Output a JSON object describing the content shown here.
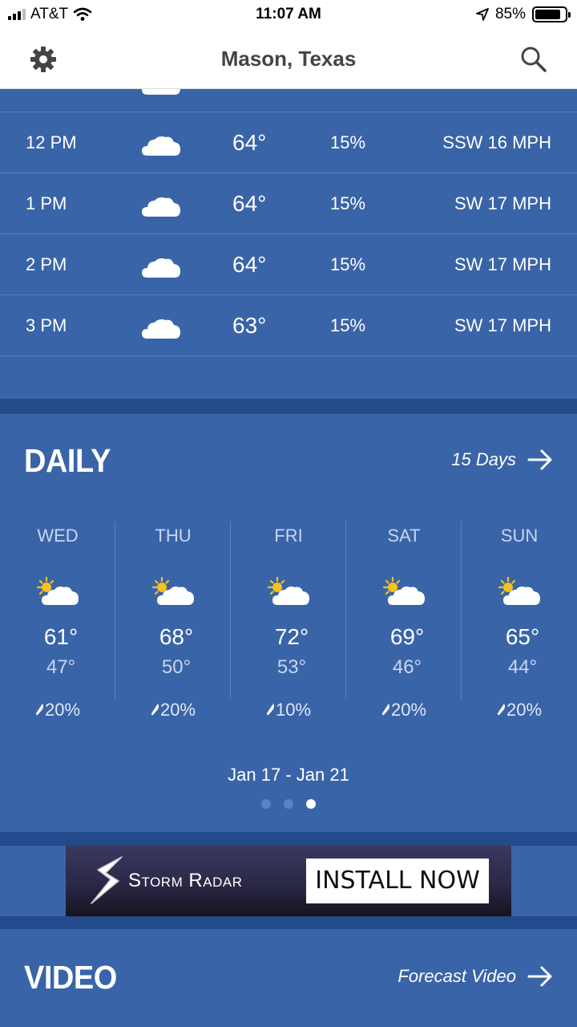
{
  "status_bar": {
    "carrier": "AT&T",
    "time": "11:07 AM",
    "battery": "85%",
    "battery_level": 0.85,
    "icons": [
      "signal-icon",
      "wifi-icon",
      "location-arrow-icon",
      "battery-icon"
    ]
  },
  "header": {
    "title": "Mason, Texas",
    "left_icon": "gear-icon",
    "right_icon": "search-icon"
  },
  "hourly": {
    "rows": [
      {
        "time": "12 PM",
        "icon": "cloud-icon",
        "temp": "64°",
        "precip": "15%",
        "wind": "SSW 16 MPH"
      },
      {
        "time": "1 PM",
        "icon": "cloud-icon",
        "temp": "64°",
        "precip": "15%",
        "wind": "SW 17 MPH"
      },
      {
        "time": "2 PM",
        "icon": "cloud-icon",
        "temp": "64°",
        "precip": "15%",
        "wind": "SW 17 MPH"
      },
      {
        "time": "3 PM",
        "icon": "cloud-icon",
        "temp": "63°",
        "precip": "15%",
        "wind": "SW 17 MPH"
      }
    ]
  },
  "daily": {
    "title": "DAILY",
    "link": "15 Days",
    "days": [
      {
        "name": "WED",
        "icon": "partly-cloudy-icon",
        "hi": "61°",
        "lo": "47°",
        "precip": "20%"
      },
      {
        "name": "THU",
        "icon": "partly-cloudy-icon",
        "hi": "68°",
        "lo": "50°",
        "precip": "20%"
      },
      {
        "name": "FRI",
        "icon": "partly-cloudy-icon",
        "hi": "72°",
        "lo": "53°",
        "precip": "10%"
      },
      {
        "name": "SAT",
        "icon": "partly-cloudy-icon",
        "hi": "69°",
        "lo": "46°",
        "precip": "20%"
      },
      {
        "name": "SUN",
        "icon": "partly-cloudy-icon",
        "hi": "65°",
        "lo": "44°",
        "precip": "20%"
      }
    ],
    "range": "Jan 17 - Jan 21",
    "pages": 3,
    "active_page": 3
  },
  "ad": {
    "brand": "Storm Radar",
    "cta": "INSTALL NOW"
  },
  "video": {
    "title": "VIDEO",
    "link": "Forecast Video"
  },
  "colors": {
    "background": "#3a64a8",
    "section_divider": "#234a8a",
    "row_divider": "#5a80bd",
    "header_bg": "#ffffff",
    "header_text": "#444444"
  }
}
